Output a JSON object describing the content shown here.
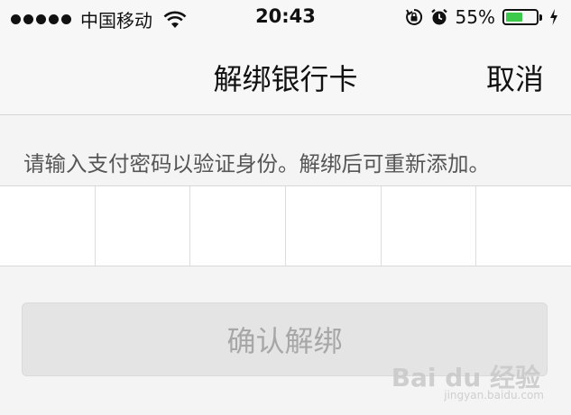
{
  "status_bar": {
    "carrier": "中国移动",
    "time": "20:43",
    "battery": "55%",
    "battery_level": 0.55,
    "battery_color": "#3cc84a",
    "icons": [
      "signal-dots-icon",
      "wifi-icon",
      "rotation-lock-icon",
      "alarm-icon",
      "battery-icon",
      "charging-bolt-icon"
    ]
  },
  "nav": {
    "title": "解绑银行卡",
    "cancel_label": "取消"
  },
  "hint": "请输入支付密码以验证身份。解绑后可重新添加。",
  "password": {
    "length": 6
  },
  "confirm_button": {
    "label": "确认解绑",
    "enabled": false
  },
  "watermark": {
    "text": "Bai du 经验",
    "url": "jingyan.baidu.com"
  }
}
